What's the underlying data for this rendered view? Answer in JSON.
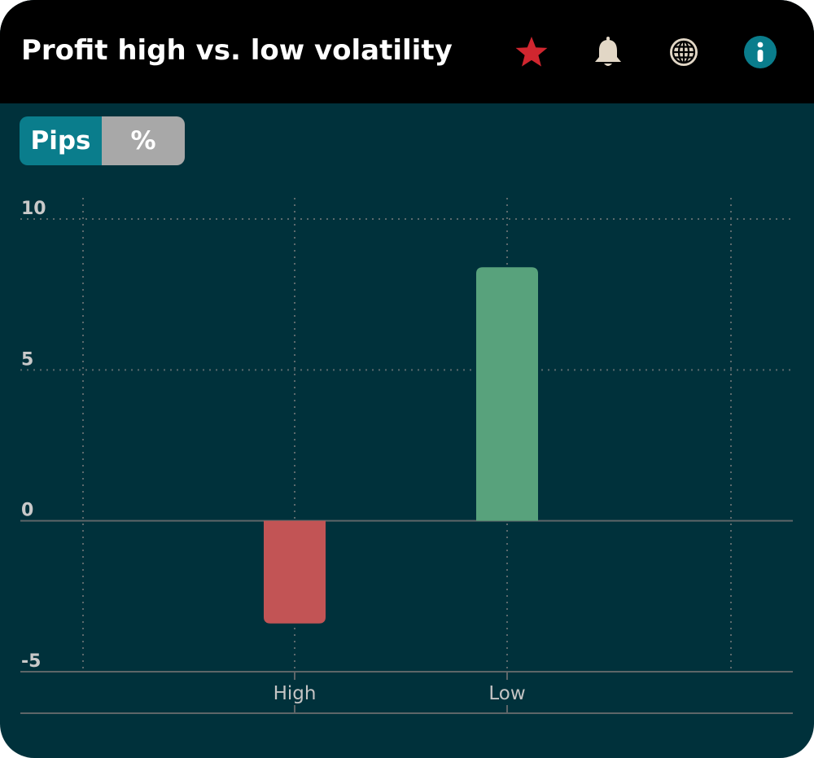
{
  "header": {
    "title": "Profit high vs. low volatility",
    "icons": [
      {
        "name": "star-icon",
        "color": "#d0262f"
      },
      {
        "name": "bell-icon",
        "color": "#e2d7c6"
      },
      {
        "name": "globe-icon",
        "color": "#e2d7c6"
      },
      {
        "name": "info-icon",
        "color": "#0a7d8c"
      }
    ]
  },
  "toggle": {
    "pips_label": "Pips",
    "percent_label": "%",
    "selected": "Pips",
    "active_color": "#0a7d8c",
    "inactive_color": "#a8a8a8"
  },
  "colors": {
    "background": "#00313b",
    "header": "#000000",
    "positive": "#58a27c",
    "negative": "#c25455"
  },
  "chart_data": {
    "type": "bar",
    "categories": [
      "High",
      "Low"
    ],
    "values": [
      -3.4,
      8.4
    ],
    "ylim": [
      -5,
      10
    ],
    "yticks": [
      10,
      5,
      0,
      -5
    ],
    "grid": true
  }
}
